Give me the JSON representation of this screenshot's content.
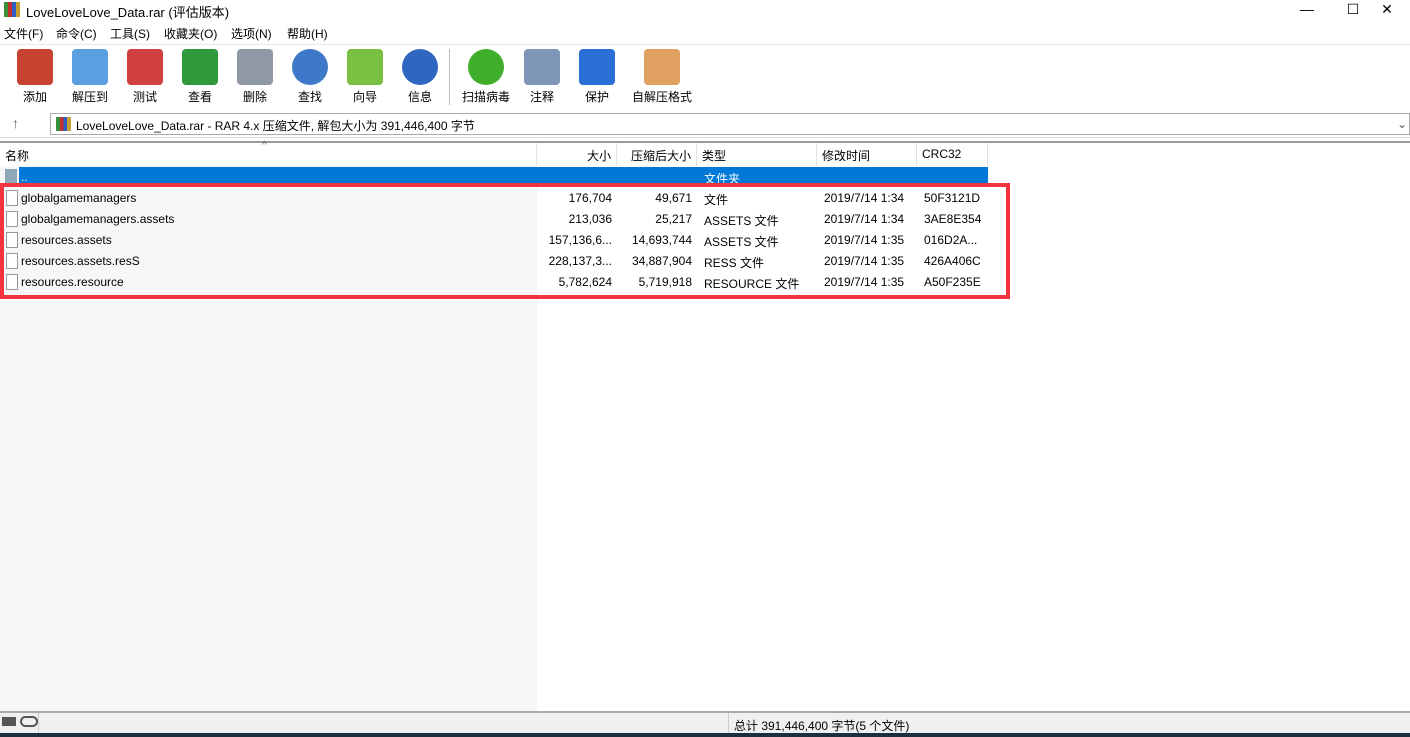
{
  "window": {
    "title": "LoveLoveLove_Data.rar (评估版本)",
    "minimize": "—",
    "maximize": "☐",
    "close": "✕"
  },
  "menu": [
    "文件(F)",
    "命令(C)",
    "工具(S)",
    "收藏夹(O)",
    "选项(N)",
    "帮助(H)"
  ],
  "toolbar": [
    {
      "label": "添加",
      "icon": "add-archive-icon",
      "color": "#c8432f"
    },
    {
      "label": "解压到",
      "icon": "extract-folder-icon",
      "color": "#5a9fe0"
    },
    {
      "label": "测试",
      "icon": "test-clipboard-icon",
      "color": "#d04040"
    },
    {
      "label": "查看",
      "icon": "view-book-icon",
      "color": "#2e9a3c"
    },
    {
      "label": "删除",
      "icon": "trash-icon",
      "color": "#8f99a5"
    },
    {
      "label": "查找",
      "icon": "magnifier-icon",
      "color": "#3e78c8"
    },
    {
      "label": "向导",
      "icon": "wizard-wand-icon",
      "color": "#7ac142"
    },
    {
      "label": "信息",
      "icon": "info-icon",
      "color": "#2f66c0"
    },
    {
      "label": "扫描病毒",
      "icon": "virus-scan-icon",
      "color": "#3fae2a"
    },
    {
      "label": "注释",
      "icon": "comment-icon",
      "color": "#7f96b8"
    },
    {
      "label": "保护",
      "icon": "shield-icon",
      "color": "#2b6fd6"
    },
    {
      "label": "自解压格式",
      "icon": "sfx-box-icon",
      "color": "#e0a060"
    }
  ],
  "address": {
    "text": "LoveLoveLove_Data.rar - RAR 4.x 压缩文件, 解包大小为 391,446,400 字节"
  },
  "columns": [
    "名称",
    "大小",
    "压缩后大小",
    "类型",
    "修改时间",
    "CRC32"
  ],
  "parent_row": {
    "name": "..",
    "type": "文件夹"
  },
  "files": [
    {
      "name": "globalgamemanagers",
      "size": "176,704",
      "packed": "49,671",
      "type": "文件",
      "modified": "2019/7/14 1:34",
      "crc": "50F3121D"
    },
    {
      "name": "globalgamemanagers.assets",
      "size": "213,036",
      "packed": "25,217",
      "type": "ASSETS 文件",
      "modified": "2019/7/14 1:34",
      "crc": "3AE8E354"
    },
    {
      "name": "resources.assets",
      "size": "157,136,6...",
      "packed": "14,693,744",
      "type": "ASSETS 文件",
      "modified": "2019/7/14 1:35",
      "crc": "016D2A..."
    },
    {
      "name": "resources.assets.resS",
      "size": "228,137,3...",
      "packed": "34,887,904",
      "type": "RESS 文件",
      "modified": "2019/7/14 1:35",
      "crc": "426A406C"
    },
    {
      "name": "resources.resource",
      "size": "5,782,624",
      "packed": "5,719,918",
      "type": "RESOURCE 文件",
      "modified": "2019/7/14 1:35",
      "crc": "A50F235E"
    }
  ],
  "status": {
    "total": "总计 391,446,400 字节(5 个文件)"
  }
}
